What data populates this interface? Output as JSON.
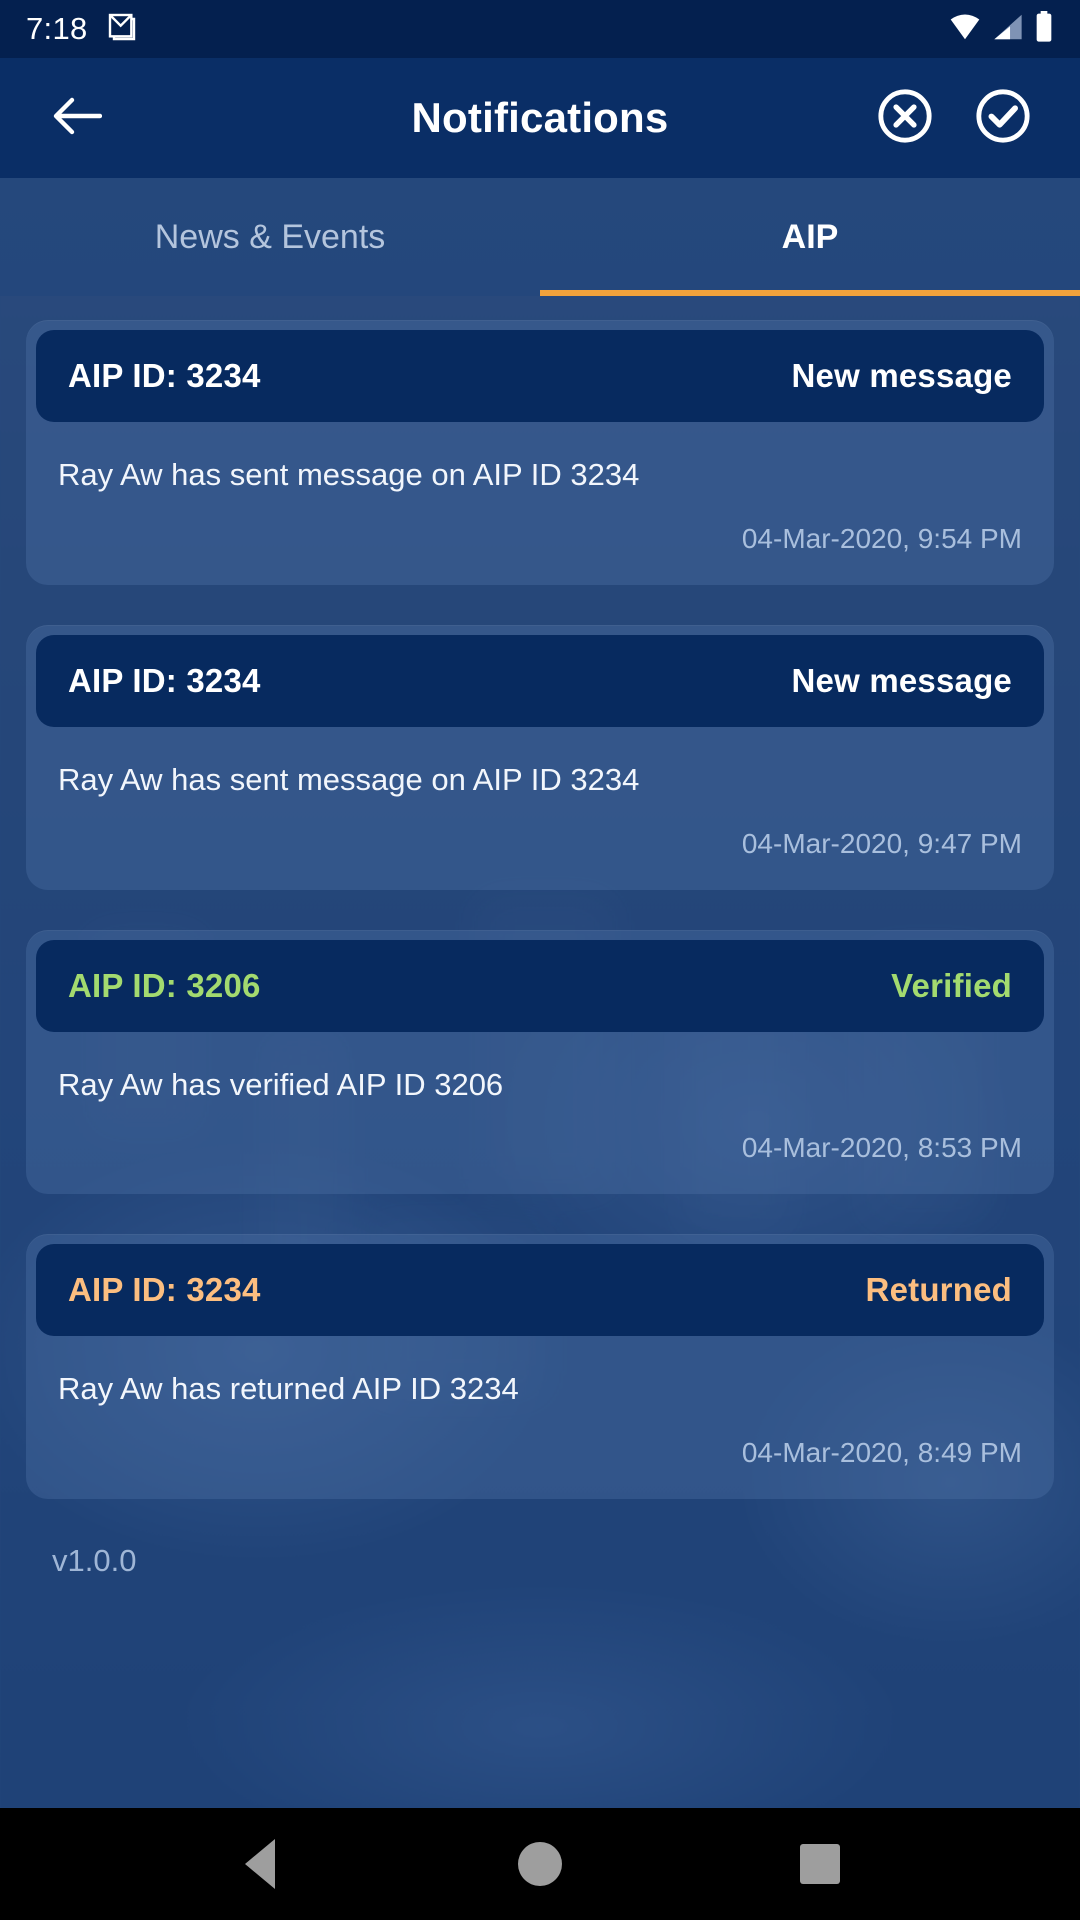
{
  "status_bar": {
    "time": "7:18",
    "icons": [
      "gmail-icon",
      "wifi-icon",
      "cellular-signal-icon",
      "battery-icon"
    ]
  },
  "app_bar": {
    "title": "Notifications",
    "back_icon": "back-arrow-icon",
    "action_clear_icon": "close-circle-icon",
    "action_mark_read_icon": "check-circle-icon"
  },
  "tabs": {
    "items": [
      {
        "label": "News & Events",
        "active": false
      },
      {
        "label": "AIP",
        "active": true
      }
    ],
    "indicator_color": "#f2a23c"
  },
  "notifications": [
    {
      "id_label": "AIP ID: 3234",
      "status": "New message",
      "status_kind": "default",
      "message": "Ray Aw has sent message on AIP ID 3234",
      "timestamp": "04-Mar-2020, 9:54 PM"
    },
    {
      "id_label": "AIP ID: 3234",
      "status": "New message",
      "status_kind": "default",
      "message": "Ray Aw has sent message on AIP ID 3234",
      "timestamp": "04-Mar-2020, 9:47 PM"
    },
    {
      "id_label": "AIP ID: 3206",
      "status": "Verified",
      "status_kind": "verified",
      "message": "Ray Aw has verified AIP ID 3206",
      "timestamp": "04-Mar-2020, 8:53 PM"
    },
    {
      "id_label": "AIP ID: 3234",
      "status": "Returned",
      "status_kind": "returned",
      "message": "Ray Aw has returned AIP ID 3234",
      "timestamp": "04-Mar-2020, 8:49 PM"
    }
  ],
  "footer": {
    "version": "v1.0.0"
  },
  "nav_bar": {
    "back": "nav-back-icon",
    "home": "nav-home-icon",
    "recents": "nav-recents-icon"
  },
  "colors": {
    "status_bar_bg": "#04204f",
    "app_bar_bg": "#0a2e66",
    "page_bg": "#24487e",
    "card_header_bg": "#072a5f",
    "accent_orange": "#f2a23c",
    "verified_green": "#a3da6f",
    "returned_orange": "#fcbe80",
    "timestamp_blue": "#a9bfdd"
  }
}
